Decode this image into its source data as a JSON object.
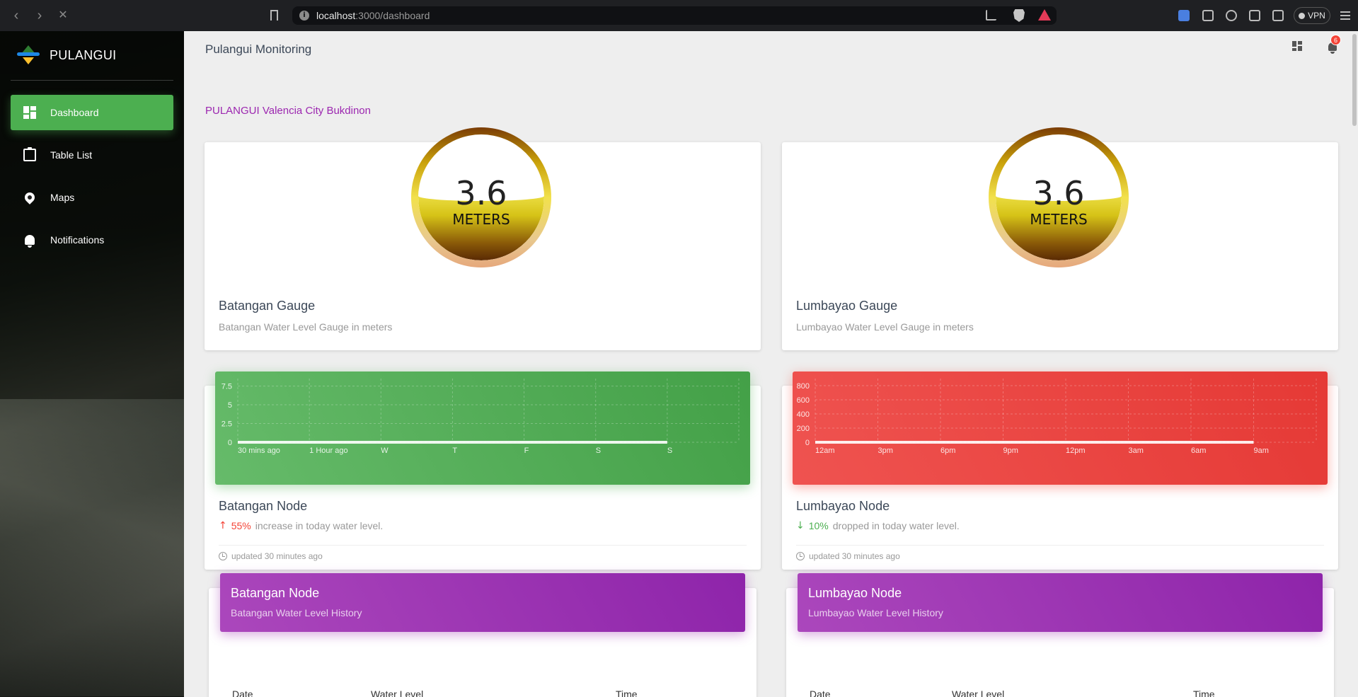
{
  "browser": {
    "url_host": "localhost",
    "url_path": ":3000/dashboard",
    "vpn_label": "VPN"
  },
  "sidebar": {
    "brand": "PULANGUI",
    "items": [
      {
        "label": "Dashboard",
        "icon": "dashboard-icon",
        "active": true
      },
      {
        "label": "Table List",
        "icon": "clipboard-icon",
        "active": false
      },
      {
        "label": "Maps",
        "icon": "location-pin-icon",
        "active": false
      },
      {
        "label": "Notifications",
        "icon": "bell-icon",
        "active": false
      }
    ]
  },
  "header": {
    "title": "Pulangui Monitoring",
    "notification_count": "6"
  },
  "location_label": "PULANGUI Valencia City Bukdinon",
  "gauges": [
    {
      "value": "3.6",
      "unit": "METERS",
      "level_fraction": 0.55,
      "title": "Batangan Gauge",
      "subtitle": "Batangan Water Level Gauge in meters"
    },
    {
      "value": "3.6",
      "unit": "METERS",
      "level_fraction": 0.55,
      "title": "Lumbayao Gauge",
      "subtitle": "Lumbayao Water Level Gauge in meters"
    }
  ],
  "nodes": [
    {
      "title": "Batangan Node",
      "change_pct": "55%",
      "change_text": "increase in today water level.",
      "direction": "up",
      "updated": "updated 30 minutes ago",
      "color": "#4caf50"
    },
    {
      "title": "Lumbayao Node",
      "change_pct": "10%",
      "change_text": "dropped in today water level.",
      "direction": "down",
      "updated": "updated 30 minutes ago",
      "color": "#f44336"
    }
  ],
  "chart_data": [
    {
      "type": "line",
      "categories": [
        "30 mins ago",
        "1 Hour ago",
        "W",
        "T",
        "F",
        "S",
        "S"
      ],
      "yticks": [
        0,
        2.5,
        5,
        7.5
      ],
      "ylim": [
        0,
        8.5
      ],
      "series": [
        {
          "values": [
            0,
            0,
            0,
            0,
            0,
            0,
            0
          ]
        }
      ],
      "grid": true
    },
    {
      "type": "line",
      "categories": [
        "12am",
        "3pm",
        "6pm",
        "9pm",
        "12pm",
        "3am",
        "6am",
        "9am"
      ],
      "yticks": [
        0,
        200,
        400,
        600,
        800
      ],
      "ylim": [
        0,
        900
      ],
      "series": [
        {
          "values": [
            0,
            0,
            0,
            0,
            0,
            0,
            0,
            0
          ]
        }
      ],
      "grid": true
    }
  ],
  "history": [
    {
      "title": "Batangan Node",
      "subtitle": "Batangan Water Level History",
      "columns": [
        "Date",
        "Water Level",
        "Time"
      ]
    },
    {
      "title": "Lumbayao Node",
      "subtitle": "Lumbayao Water Level History",
      "columns": [
        "Date",
        "Water Level",
        "Time"
      ]
    }
  ]
}
